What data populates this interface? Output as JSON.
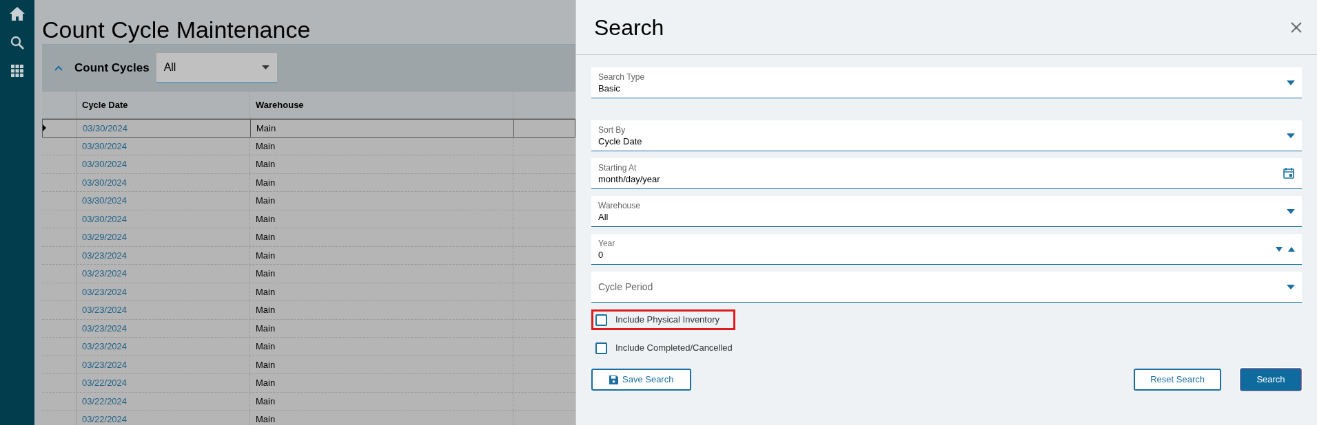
{
  "page": {
    "title": "Count Cycle Maintenance"
  },
  "grid": {
    "title": "Count Cycles",
    "filter": "All",
    "columns": [
      "Cycle Date",
      "Warehouse"
    ],
    "rows": [
      {
        "cycle_date": "03/30/2024",
        "warehouse": "Main",
        "selected": true
      },
      {
        "cycle_date": "03/30/2024",
        "warehouse": "Main",
        "selected": false
      },
      {
        "cycle_date": "03/30/2024",
        "warehouse": "Main",
        "selected": false
      },
      {
        "cycle_date": "03/30/2024",
        "warehouse": "Main",
        "selected": false
      },
      {
        "cycle_date": "03/30/2024",
        "warehouse": "Main",
        "selected": false
      },
      {
        "cycle_date": "03/30/2024",
        "warehouse": "Main",
        "selected": false
      },
      {
        "cycle_date": "03/29/2024",
        "warehouse": "Main",
        "selected": false
      },
      {
        "cycle_date": "03/23/2024",
        "warehouse": "Main",
        "selected": false
      },
      {
        "cycle_date": "03/23/2024",
        "warehouse": "Main",
        "selected": false
      },
      {
        "cycle_date": "03/23/2024",
        "warehouse": "Main",
        "selected": false
      },
      {
        "cycle_date": "03/23/2024",
        "warehouse": "Main",
        "selected": false
      },
      {
        "cycle_date": "03/23/2024",
        "warehouse": "Main",
        "selected": false
      },
      {
        "cycle_date": "03/23/2024",
        "warehouse": "Main",
        "selected": false
      },
      {
        "cycle_date": "03/23/2024",
        "warehouse": "Main",
        "selected": false
      },
      {
        "cycle_date": "03/22/2024",
        "warehouse": "Main",
        "selected": false
      },
      {
        "cycle_date": "03/22/2024",
        "warehouse": "Main",
        "selected": false
      },
      {
        "cycle_date": "03/22/2024",
        "warehouse": "Main",
        "selected": false
      }
    ]
  },
  "search_panel": {
    "title": "Search",
    "fields": [
      {
        "kind": "select",
        "label": "Search Type",
        "value": "Basic"
      },
      {
        "kind": "select",
        "label": "Sort By",
        "value": "Cycle Date"
      },
      {
        "kind": "date",
        "label": "Starting At",
        "value": "month/day/year"
      },
      {
        "kind": "select",
        "label": "Warehouse",
        "value": "All"
      },
      {
        "kind": "number",
        "label": "Year",
        "value": "0"
      },
      {
        "kind": "select",
        "placeholder": "Cycle Period"
      }
    ],
    "checkboxes": [
      {
        "label": "Include Physical Inventory",
        "checked": false,
        "highlighted": true
      },
      {
        "label": "Include Completed/Cancelled",
        "checked": false,
        "highlighted": false
      }
    ],
    "buttons": {
      "save": "Save Search",
      "reset": "Reset Search",
      "search": "Search"
    }
  }
}
